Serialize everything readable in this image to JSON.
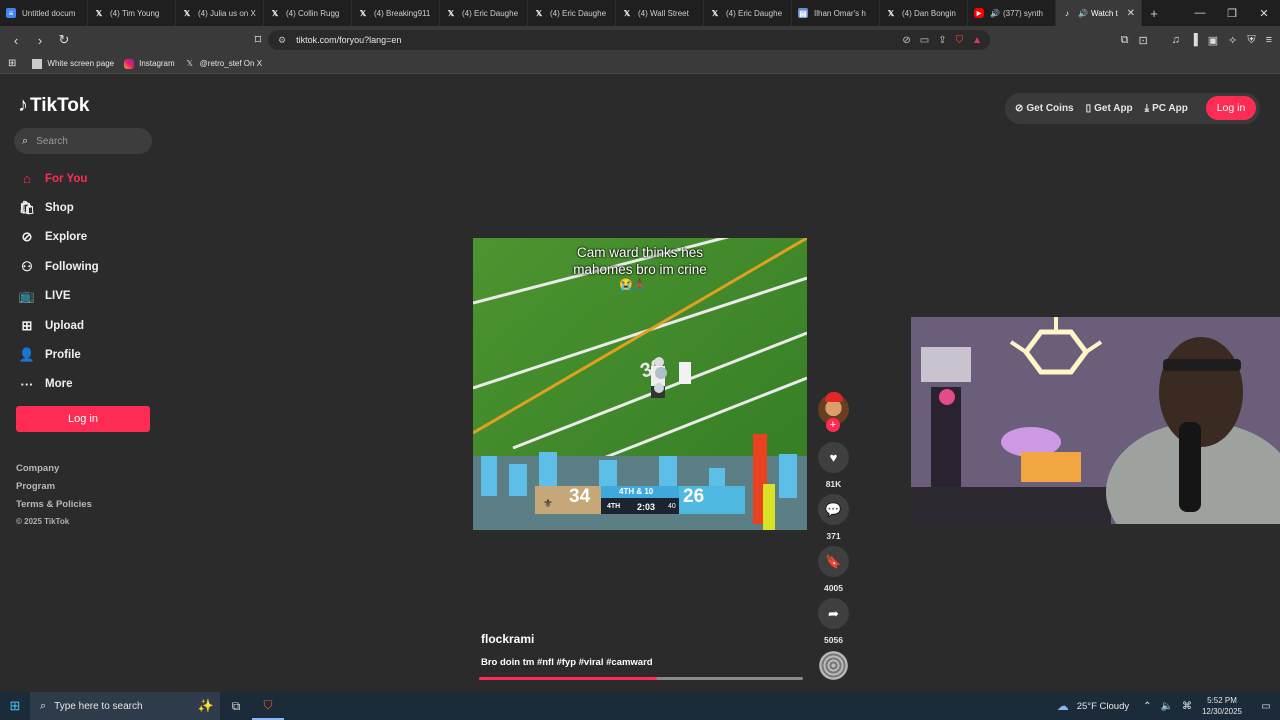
{
  "browser": {
    "tabs": [
      {
        "title": "Untitled docum",
        "icon": "docs-icon"
      },
      {
        "title": "(4) Tim Young",
        "icon": "x-icon"
      },
      {
        "title": "(4) Julia us on X",
        "icon": "x-icon"
      },
      {
        "title": "(4) Collin Rugg",
        "icon": "x-icon"
      },
      {
        "title": "(4) Breaking911",
        "icon": "x-icon"
      },
      {
        "title": "(4) Eric Daughe",
        "icon": "x-icon"
      },
      {
        "title": "(4) Eric Daughe",
        "icon": "x-icon"
      },
      {
        "title": "(4) Wall Street",
        "icon": "x-icon"
      },
      {
        "title": "(4) Eric Daughe",
        "icon": "x-icon"
      },
      {
        "title": "Ilhan Omar's h",
        "icon": "news-icon"
      },
      {
        "title": "(4) Dan Bongin",
        "icon": "x-icon"
      },
      {
        "title": "(377) synth",
        "icon": "youtube-icon"
      },
      {
        "title": "Watch t",
        "icon": "tiktok-icon"
      }
    ],
    "url": "tiktok.com/foryou?lang=en",
    "bookmarks": [
      {
        "label": "White screen page",
        "icon": "page-icon"
      },
      {
        "label": "Instagram",
        "icon": "instagram-icon"
      },
      {
        "label": "@retro_stef On X",
        "icon": "x-icon"
      }
    ]
  },
  "tiktok": {
    "logo": "TikTok",
    "search_placeholder": "Search",
    "nav": [
      {
        "label": "For You",
        "icon": "home-icon",
        "active": true
      },
      {
        "label": "Shop",
        "icon": "shop-icon"
      },
      {
        "label": "Explore",
        "icon": "compass-icon"
      },
      {
        "label": "Following",
        "icon": "following-icon"
      },
      {
        "label": "LIVE",
        "icon": "live-icon"
      },
      {
        "label": "Upload",
        "icon": "upload-icon"
      },
      {
        "label": "Profile",
        "icon": "profile-icon"
      },
      {
        "label": "More",
        "icon": "more-icon"
      }
    ],
    "login_label": "Log in",
    "footer": {
      "company": "Company",
      "program": "Program",
      "terms": "Terms & Policies",
      "copyright": "© 2025 TikTok"
    },
    "top_actions": {
      "get_coins": "Get Coins",
      "get_app": "Get App",
      "pc_app": "PC App",
      "login": "Log in"
    },
    "video": {
      "caption_line1": "Cam ward thinks hes",
      "caption_line2": "mahomes bro im crine",
      "emojis": "😭🙏🏾",
      "scoreboard": {
        "home_score": "34",
        "away_score": "26",
        "down": "4TH & 10",
        "quarter": "4TH",
        "clock": "2:03",
        "play_clock": "40"
      },
      "author": "flockrami",
      "description": "Bro doin tm #nfl #fyp #viral #camward",
      "progress": 0.55,
      "likes": "81K",
      "comments": "371",
      "saves": "4005",
      "shares": "5056"
    }
  },
  "taskbar": {
    "search_placeholder": "Type here to search",
    "weather": "25°F  Cloudy",
    "time": "5:52 PM",
    "date": "12/30/2025"
  }
}
